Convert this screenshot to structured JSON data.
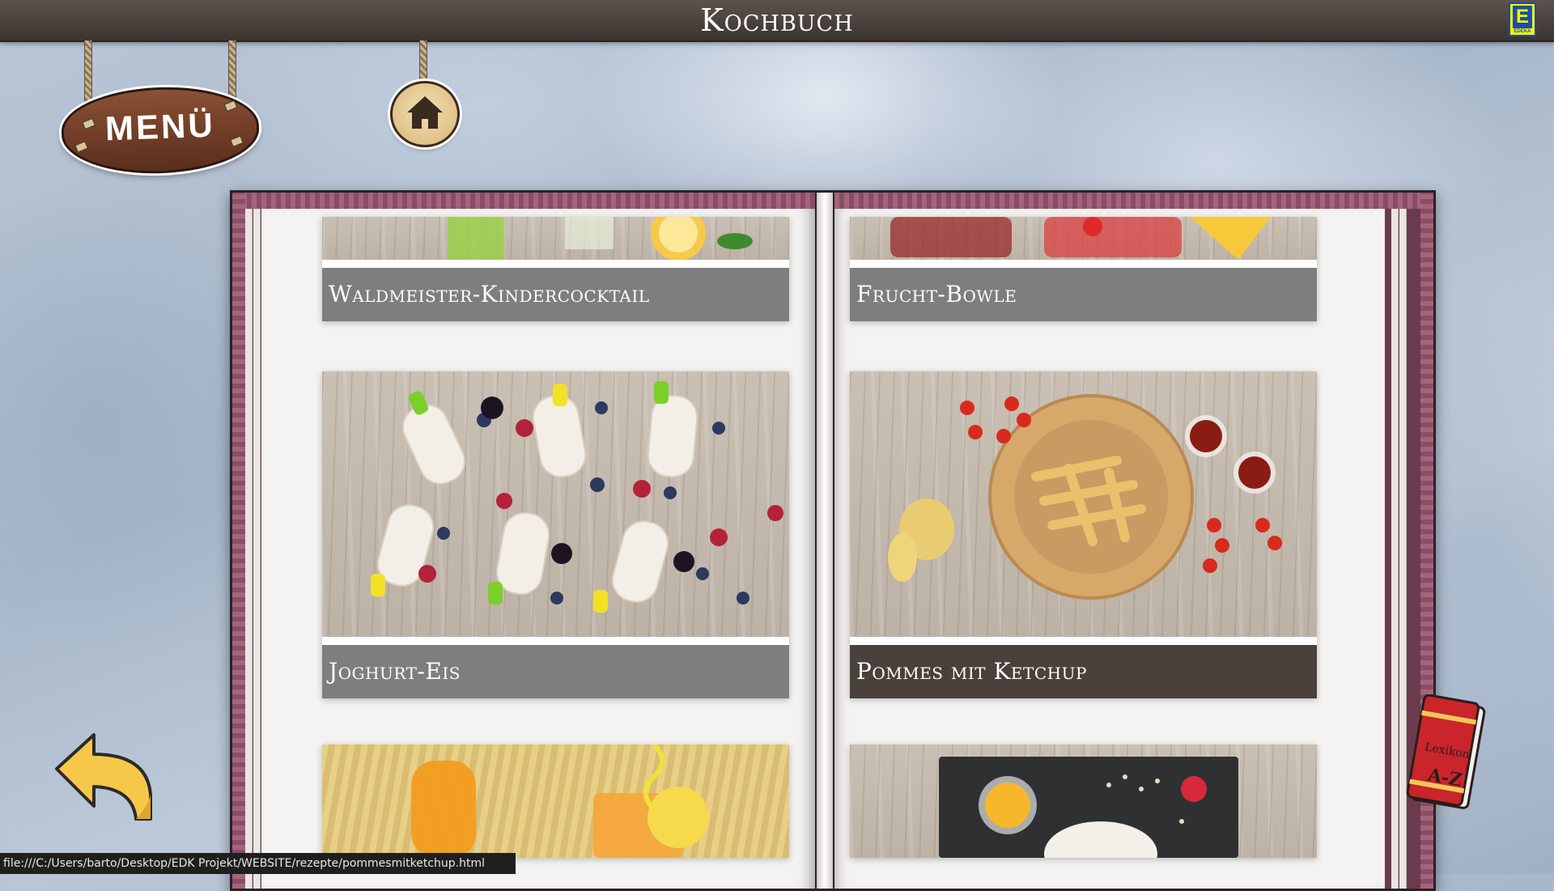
{
  "header": {
    "title": "Kochbuch",
    "brand_logo": "EDEKA",
    "brand_mark": "E"
  },
  "nav": {
    "menu_label": "MENÜ",
    "home_icon": "home-icon",
    "back_icon": "back-arrow-icon",
    "lexikon_label_top": "Lexikon",
    "lexikon_label_bottom": "A-Z"
  },
  "recipes": {
    "row1_left": "Waldmeister-Kindercocktail",
    "row1_right": "Frucht-Bowle",
    "row2_left": "Joghurt-Eis",
    "row2_right": "Pommes mit Ketchup",
    "active": "Pommes mit Ketchup"
  },
  "status_bar": {
    "url": "file:///C:/Users/barto/Desktop/EDK Projekt/WEBSITE/rezepte/pommesmitketchup.html"
  },
  "colors": {
    "topbar": "#4a413c",
    "book_cover": "#6a3a4d",
    "label_default": "#7e7e80",
    "label_active": "#4a403c",
    "edeka_yellow": "#fff200",
    "edeka_blue": "#1b4fa3"
  }
}
